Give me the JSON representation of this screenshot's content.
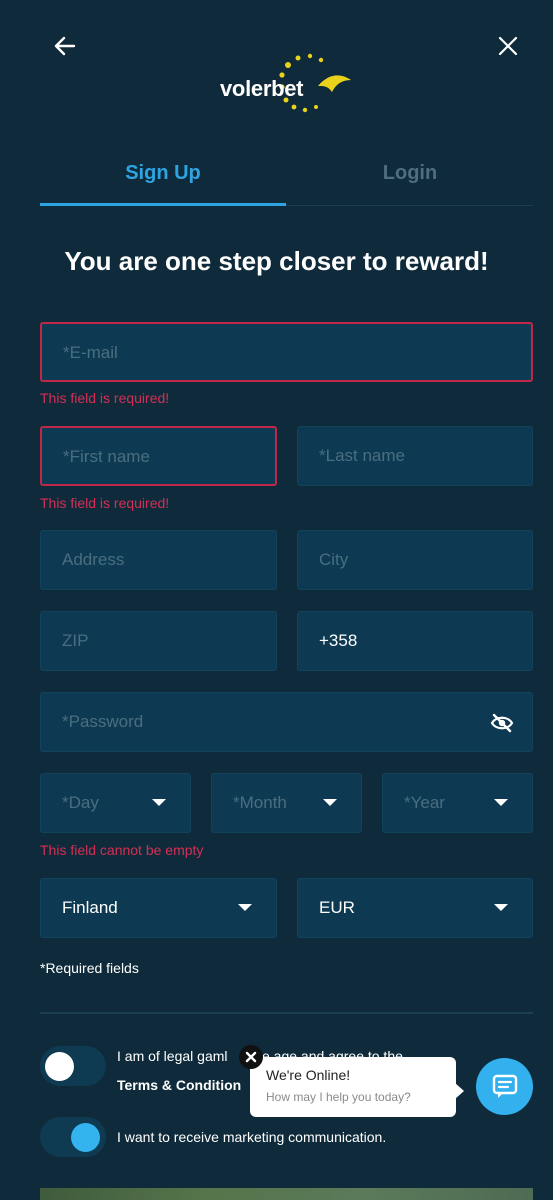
{
  "logo": {
    "text_left": "voler",
    "text_right": "bet"
  },
  "tabs": [
    {
      "label": "Sign Up"
    },
    {
      "label": "Login"
    }
  ],
  "headline": "You are one step closer to reward!",
  "form": {
    "email": {
      "placeholder": "*E-mail",
      "error": "This field is required!"
    },
    "first_name": {
      "placeholder": "*First name",
      "error": "This field is required!"
    },
    "last_name": {
      "placeholder": "*Last name"
    },
    "address": {
      "placeholder": "Address"
    },
    "city": {
      "placeholder": "City"
    },
    "zip": {
      "placeholder": "ZIP"
    },
    "phone": {
      "value": "+358"
    },
    "password": {
      "placeholder": "*Password"
    },
    "day": {
      "placeholder": "*Day"
    },
    "month": {
      "placeholder": "*Month"
    },
    "year": {
      "placeholder": "*Year"
    },
    "dob_error": "This field cannot be empty",
    "country": {
      "value": "Finland"
    },
    "currency": {
      "value": "EUR"
    },
    "required_note": "*Required fields"
  },
  "consent": {
    "age_text": "I am of legal gaml",
    "age_text_tail": "e age and agree to the",
    "terms_link": "Terms & Condition",
    "marketing_text": "I want to receive marketing communication.",
    "age_toggle": "off",
    "marketing_toggle": "on"
  },
  "chat": {
    "title": "We're Online!",
    "subtitle": "How may I help you today?"
  },
  "colors": {
    "background": "#0f2b3b",
    "accent": "#2ea4e3",
    "error": "#d42e55",
    "logo_dots": "#e8d21b"
  }
}
